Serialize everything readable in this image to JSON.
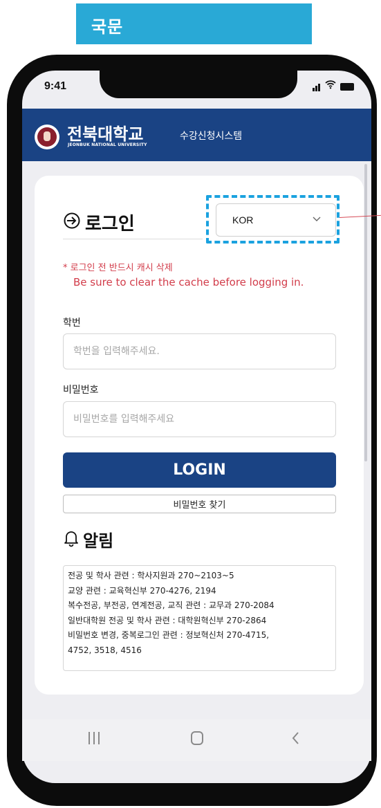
{
  "tag_label": "국문",
  "status_bar": {
    "time": "9:41"
  },
  "header": {
    "university_name": "전북대학교",
    "university_name_en": "JEONBUK NATIONAL UNIVERSITY",
    "system_name": "수강신청시스템"
  },
  "login": {
    "title": "로그인",
    "language": {
      "selected": "KOR"
    },
    "notice_ko": "* 로그인 전 반드시 캐시 삭제",
    "notice_en": "Be sure to clear the cache before logging in.",
    "student_id_label": "학번",
    "student_id_placeholder": "학번을 입력해주세요.",
    "password_label": "비밀번호",
    "password_placeholder": "비밀번호를 입력해주세요",
    "login_button": "LOGIN",
    "find_password_button": "비밀번호 찾기"
  },
  "notices": {
    "title": "알림",
    "lines": [
      "전공 및 학사 관련 : 학사지원과 270~2103~5",
      "교양 관련 : 교육혁신부 270-4276, 2194",
      "복수전공, 부전공, 연계전공, 교직 관련 : 교무과 270-2084",
      "일반대학원 전공 및 학사 관련 : 대학원혁신부 270-2864",
      "비밀번호 변경, 중복로그인 관련 : 정보혁신처 270-4715,",
      "4752, 3518, 4516"
    ]
  },
  "colors": {
    "header_bg": "#1a4384",
    "tag_bg": "#29a9d6",
    "highlight_dash": "#1ba2df",
    "notice_red": "#d23c4a"
  }
}
